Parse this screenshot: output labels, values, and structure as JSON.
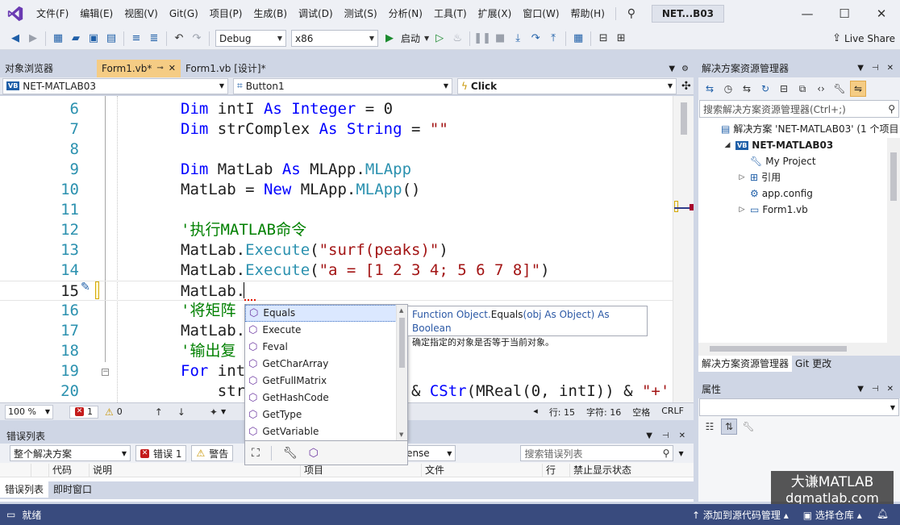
{
  "menubar": {
    "items": [
      "文件(F)",
      "编辑(E)",
      "视图(V)",
      "Git(G)",
      "项目(P)",
      "生成(B)",
      "调试(D)",
      "测试(S)",
      "分析(N)",
      "工具(T)",
      "扩展(X)",
      "窗口(W)",
      "帮助(H)"
    ],
    "solution_badge": "NET...B03"
  },
  "toolbar": {
    "config": "Debug",
    "platform": "x86",
    "start_label": "启动",
    "live_share": "Live Share"
  },
  "doc_tabs": {
    "left_panel": "对象浏览器",
    "active": "Form1.vb*",
    "pin_glyph": "⊸",
    "design": "Form1.vb [设计]*"
  },
  "nav": {
    "project": "NET-MATLAB03",
    "object": "Button1",
    "event": "Click"
  },
  "code_lines": [
    {
      "num": "6",
      "parts": [
        [
          "kw",
          "Dim "
        ],
        [
          "",
          "intI "
        ],
        [
          "kw",
          "As Integer"
        ],
        [
          "",
          " = 0"
        ]
      ]
    },
    {
      "num": "7",
      "parts": [
        [
          "kw",
          "Dim "
        ],
        [
          "",
          "strComplex "
        ],
        [
          "kw",
          "As String"
        ],
        [
          "",
          " = "
        ],
        [
          "str",
          "\"\""
        ]
      ]
    },
    {
      "num": "8",
      "parts": []
    },
    {
      "num": "9",
      "parts": [
        [
          "kw",
          "Dim "
        ],
        [
          "",
          "MatLab "
        ],
        [
          "kw",
          "As "
        ],
        [
          "",
          "MLApp."
        ],
        [
          "ty",
          "MLApp"
        ]
      ]
    },
    {
      "num": "10",
      "parts": [
        [
          "",
          "MatLab = "
        ],
        [
          "kw",
          "New "
        ],
        [
          "",
          "MLApp."
        ],
        [
          "ty",
          "MLApp"
        ],
        [
          "",
          "()"
        ]
      ]
    },
    {
      "num": "11",
      "parts": []
    },
    {
      "num": "12",
      "parts": [
        [
          "cm",
          "'执行MATLAB命令"
        ]
      ]
    },
    {
      "num": "13",
      "parts": [
        [
          "",
          "MatLab."
        ],
        [
          "ty",
          "Execute"
        ],
        [
          "",
          "("
        ],
        [
          "str",
          "\"surf(peaks)\""
        ],
        [
          "",
          ")"
        ]
      ]
    },
    {
      "num": "14",
      "parts": [
        [
          "",
          "MatLab."
        ],
        [
          "ty",
          "Execute"
        ],
        [
          "",
          "("
        ],
        [
          "str",
          "\"a = [1 2 3 4; 5 6 7 8]\""
        ],
        [
          "",
          ")"
        ]
      ]
    },
    {
      "num": "15",
      "parts": [
        [
          "",
          "MatLab."
        ]
      ]
    },
    {
      "num": "16",
      "parts": [
        [
          "cm",
          "'将矩阵"
        ]
      ]
    },
    {
      "num": "17",
      "parts": [
        [
          "",
          "MatLab."
        ]
      ]
    },
    {
      "num": "18",
      "parts": [
        [
          "cm",
          "'输出复"
        ]
      ]
    },
    {
      "num": "19",
      "parts": [
        [
          "kw",
          "For "
        ],
        [
          "",
          "int"
        ]
      ]
    },
    {
      "num": "20",
      "parts": [
        [
          "",
          "    str                x & "
        ],
        [
          "kw",
          "CStr"
        ],
        [
          "",
          "(MReal(0, intI)) & "
        ],
        [
          "str",
          "\"+'"
        ]
      ]
    }
  ],
  "intellisense": {
    "items": [
      "Equals",
      "Execute",
      "Feval",
      "GetCharArray",
      "GetFullMatrix",
      "GetHashCode",
      "GetType",
      "GetVariable"
    ],
    "selected_index": 0,
    "tooltip_prefix": "Function Object.",
    "tooltip_method": "Equals",
    "tooltip_suffix": "(obj As Object) As Boolean",
    "tooltip_desc": "确定指定的对象是否等于当前对象。"
  },
  "editor_status": {
    "zoom": "100 %",
    "errors": "1",
    "warnings": "0",
    "line": "行: 15",
    "col": "字符: 16",
    "space": "空格",
    "eol": "CRLF"
  },
  "error_list": {
    "title": "错误列表",
    "scope": "整个解决方案",
    "errors_btn": "错误 1",
    "warnings_btn": "警告",
    "build_combo": "Sense",
    "search_placeholder": "搜索错误列表",
    "cols": [
      "代码",
      "说明",
      "项目",
      "文件",
      "行",
      "禁止显示状态"
    ],
    "tabs": [
      "错误列表",
      "即时窗口"
    ]
  },
  "solution_explorer": {
    "title": "解决方案资源管理器",
    "search_placeholder": "搜索解决方案资源管理器(Ctrl+;)",
    "tree": [
      {
        "label": "解决方案 'NET-MATLAB03' (1 个项目",
        "level": 0,
        "exp": "",
        "icon": "sln"
      },
      {
        "label": "NET-MATLAB03",
        "level": 1,
        "exp": "◢",
        "icon": "vb",
        "bold": true
      },
      {
        "label": "My Project",
        "level": 2,
        "exp": "",
        "icon": "wrench"
      },
      {
        "label": "引用",
        "level": 2,
        "exp": "▷",
        "icon": "ref"
      },
      {
        "label": "app.config",
        "level": 2,
        "exp": "",
        "icon": "config"
      },
      {
        "label": "Form1.vb",
        "level": 2,
        "exp": "▷",
        "icon": "form"
      }
    ],
    "tabs": [
      "解决方案资源管理器",
      "Git 更改"
    ]
  },
  "properties": {
    "title": "属性"
  },
  "watermark": {
    "line1": "大谦MATLAB",
    "line2": "dqmatlab.com"
  },
  "statusbar": {
    "ready": "就绪",
    "source_control": "添加到源代码管理",
    "repo": "选择仓库"
  },
  "colors": {
    "accent_tab": "#f5cc84",
    "statusbar": "#394b7e",
    "keyword": "#0000ff",
    "string": "#a31515",
    "comment": "#008000",
    "type": "#2b91af"
  }
}
